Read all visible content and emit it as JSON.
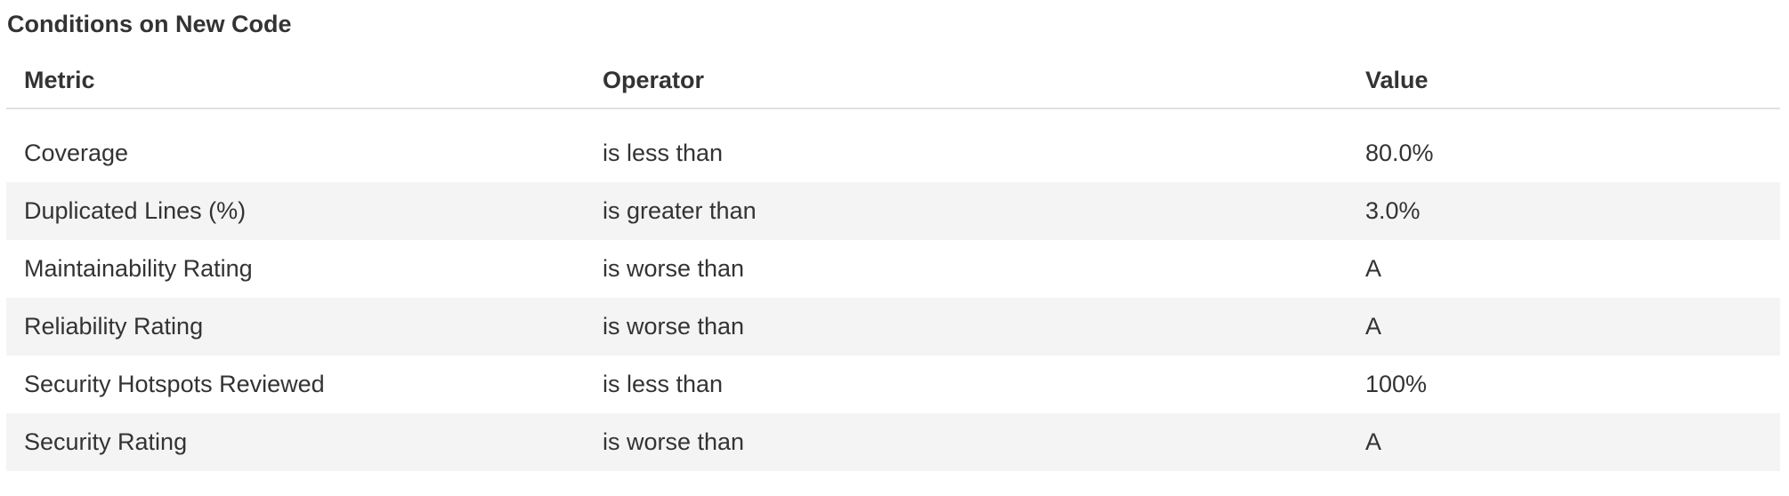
{
  "section": {
    "title": "Conditions on New Code"
  },
  "table": {
    "headers": {
      "metric": "Metric",
      "operator": "Operator",
      "value": "Value"
    },
    "rows": [
      {
        "metric": "Coverage",
        "operator": "is less than",
        "value": "80.0%"
      },
      {
        "metric": "Duplicated Lines (%)",
        "operator": "is greater than",
        "value": "3.0%"
      },
      {
        "metric": "Maintainability Rating",
        "operator": "is worse than",
        "value": "A"
      },
      {
        "metric": "Reliability Rating",
        "operator": "is worse than",
        "value": "A"
      },
      {
        "metric": "Security Hotspots Reviewed",
        "operator": "is less than",
        "value": "100%"
      },
      {
        "metric": "Security Rating",
        "operator": "is worse than",
        "value": "A"
      }
    ]
  },
  "colors": {
    "text": "#333333",
    "row_stripe": "#f4f4f4",
    "header_border": "#e1e1e1",
    "background": "#ffffff"
  }
}
